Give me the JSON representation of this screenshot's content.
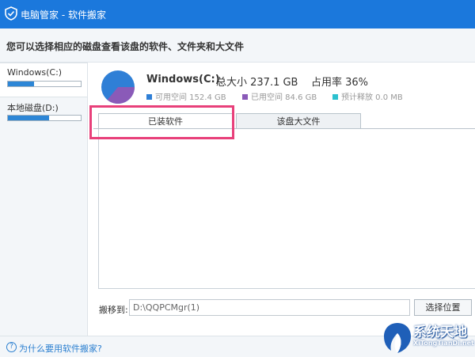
{
  "window": {
    "title": "电脑管家 - 软件搬家"
  },
  "header": {
    "description": "您可以选择相应的磁盘查看该盘的软件、文件夹和大文件"
  },
  "sidebar": {
    "drives": [
      {
        "label": "Windows(C:)",
        "usage_fraction": 0.36
      },
      {
        "label": "本地磁盘(D:)",
        "usage_fraction": 0.56
      }
    ]
  },
  "disk": {
    "name": "Windows(C:)",
    "total": "总大小 237.1 GB",
    "usage": "占用率 36%",
    "usage_fraction": 0.36,
    "legend": [
      {
        "label": "可用空间 152.4 GB",
        "color": "#2f7fd6"
      },
      {
        "label": "已用空间 84.6 GB",
        "color": "#8a5ab8"
      },
      {
        "label": "预计释放 0.0 MB",
        "color": "#2cc1cf"
      }
    ]
  },
  "tabs": [
    {
      "label": "已装软件"
    },
    {
      "label": "该盘大文件"
    }
  ],
  "move": {
    "label": "搬移到:",
    "path": "D:\\QQPCMgr(1)",
    "select_button": "选择位置"
  },
  "footer": {
    "help_icon": "?",
    "help_link": "为什么要用软件搬家?"
  },
  "watermark": {
    "title": "系统天地",
    "subtitle": "XiTongTianDi.net"
  }
}
